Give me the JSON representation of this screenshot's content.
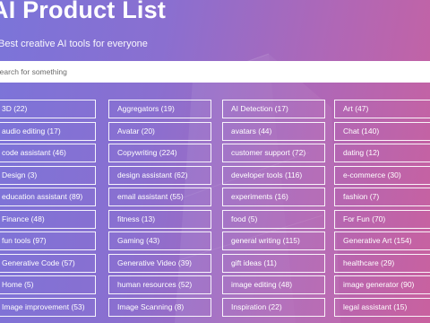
{
  "header": {
    "title": "AI Product List",
    "subtitle": "Best creative AI tools for everyone"
  },
  "search": {
    "placeholder": "Search for something"
  },
  "columns": [
    [
      "3D  (22)",
      "audio editing  (17)",
      "code assistant  (46)",
      "Design  (3)",
      "education assistant  (89)",
      "Finance  (48)",
      "fun tools  (97)",
      "Generative Code  (57)",
      "Home  (5)",
      "Image improvement  (53)"
    ],
    [
      "Aggregators  (19)",
      "Avatar  (20)",
      "Copywriting  (224)",
      "design assistant  (62)",
      "email assistant  (55)",
      "fitness  (13)",
      "Gaming  (43)",
      "Generative Video  (39)",
      "human resources  (52)",
      "Image Scanning  (8)"
    ],
    [
      "AI Detection  (17)",
      "avatars  (44)",
      "customer support  (72)",
      "developer tools  (116)",
      "experiments  (16)",
      "food  (5)",
      "general writing  (115)",
      "gift ideas  (11)",
      "image editing  (48)",
      "Inspiration  (22)"
    ],
    [
      "Art  (47)",
      "Chat  (140)",
      "dating  (12)",
      "e-commerce  (30)",
      "fashion  (7)",
      "For Fun  (70)",
      "Generative Art  (154)",
      "healthcare  (29)",
      "image generator  (90)",
      "legal assistant  (15)"
    ]
  ],
  "colors": {
    "gradient_start": "#7b74d9",
    "gradient_end": "#c9619f",
    "tag_border": "#ffffff",
    "search_bg": "#ffffff"
  }
}
